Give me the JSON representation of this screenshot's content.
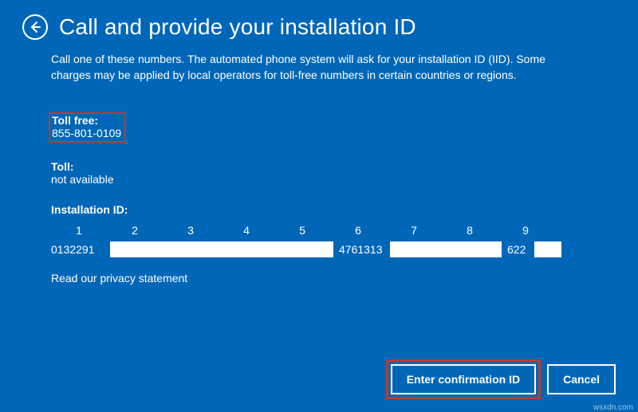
{
  "header": {
    "title": "Call and provide your installation ID"
  },
  "description": "Call one of these numbers. The automated phone system will ask for your installation ID (IID). Some charges may be applied by local operators for toll-free numbers in certain countries or regions.",
  "toll_free": {
    "label": "Toll free:",
    "value": "855-801-0109"
  },
  "toll": {
    "label": "Toll:",
    "value": "not available"
  },
  "iid": {
    "label": "Installation ID:",
    "headers": [
      "1",
      "2",
      "3",
      "4",
      "5",
      "6",
      "7",
      "8",
      "9"
    ],
    "seg1": "0132291",
    "seg6": "4761313",
    "seg9": "622"
  },
  "privacy_link": "Read our privacy statement",
  "buttons": {
    "enter": "Enter confirmation ID",
    "cancel": "Cancel"
  },
  "watermark": "wsxdn.com"
}
